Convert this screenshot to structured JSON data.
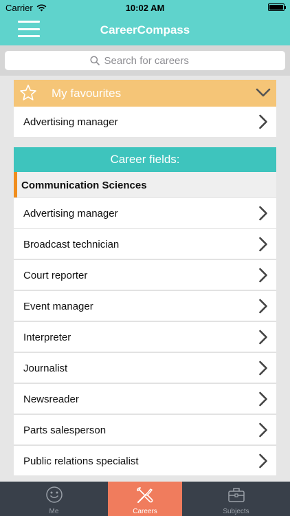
{
  "status_bar": {
    "carrier": "Carrier",
    "time": "10:02 AM"
  },
  "nav": {
    "title": "CareerCompass"
  },
  "search": {
    "placeholder": "Search for careers"
  },
  "favourites": {
    "title": "My favourites",
    "items": [
      "Advertising manager"
    ]
  },
  "career_fields": {
    "title": "Career fields:",
    "section": "Communication Sciences",
    "items": [
      "Advertising manager",
      "Broadcast technician",
      "Court reporter",
      "Event manager",
      "Interpreter",
      "Journalist",
      "Newsreader",
      "Parts salesperson",
      "Public relations specialist"
    ]
  },
  "tabs": [
    {
      "label": "Me",
      "icon": "smiley-icon",
      "active": false
    },
    {
      "label": "Careers",
      "icon": "tools-icon",
      "active": true
    },
    {
      "label": "Subjects",
      "icon": "briefcase-icon",
      "active": false
    }
  ],
  "colors": {
    "nav": "#5fd3cc",
    "favourites": "#f5c577",
    "fields_header": "#3ec4bd",
    "section_accent": "#f08d1d",
    "active_tab": "#f07c5d",
    "tab_bar": "#39404a"
  }
}
